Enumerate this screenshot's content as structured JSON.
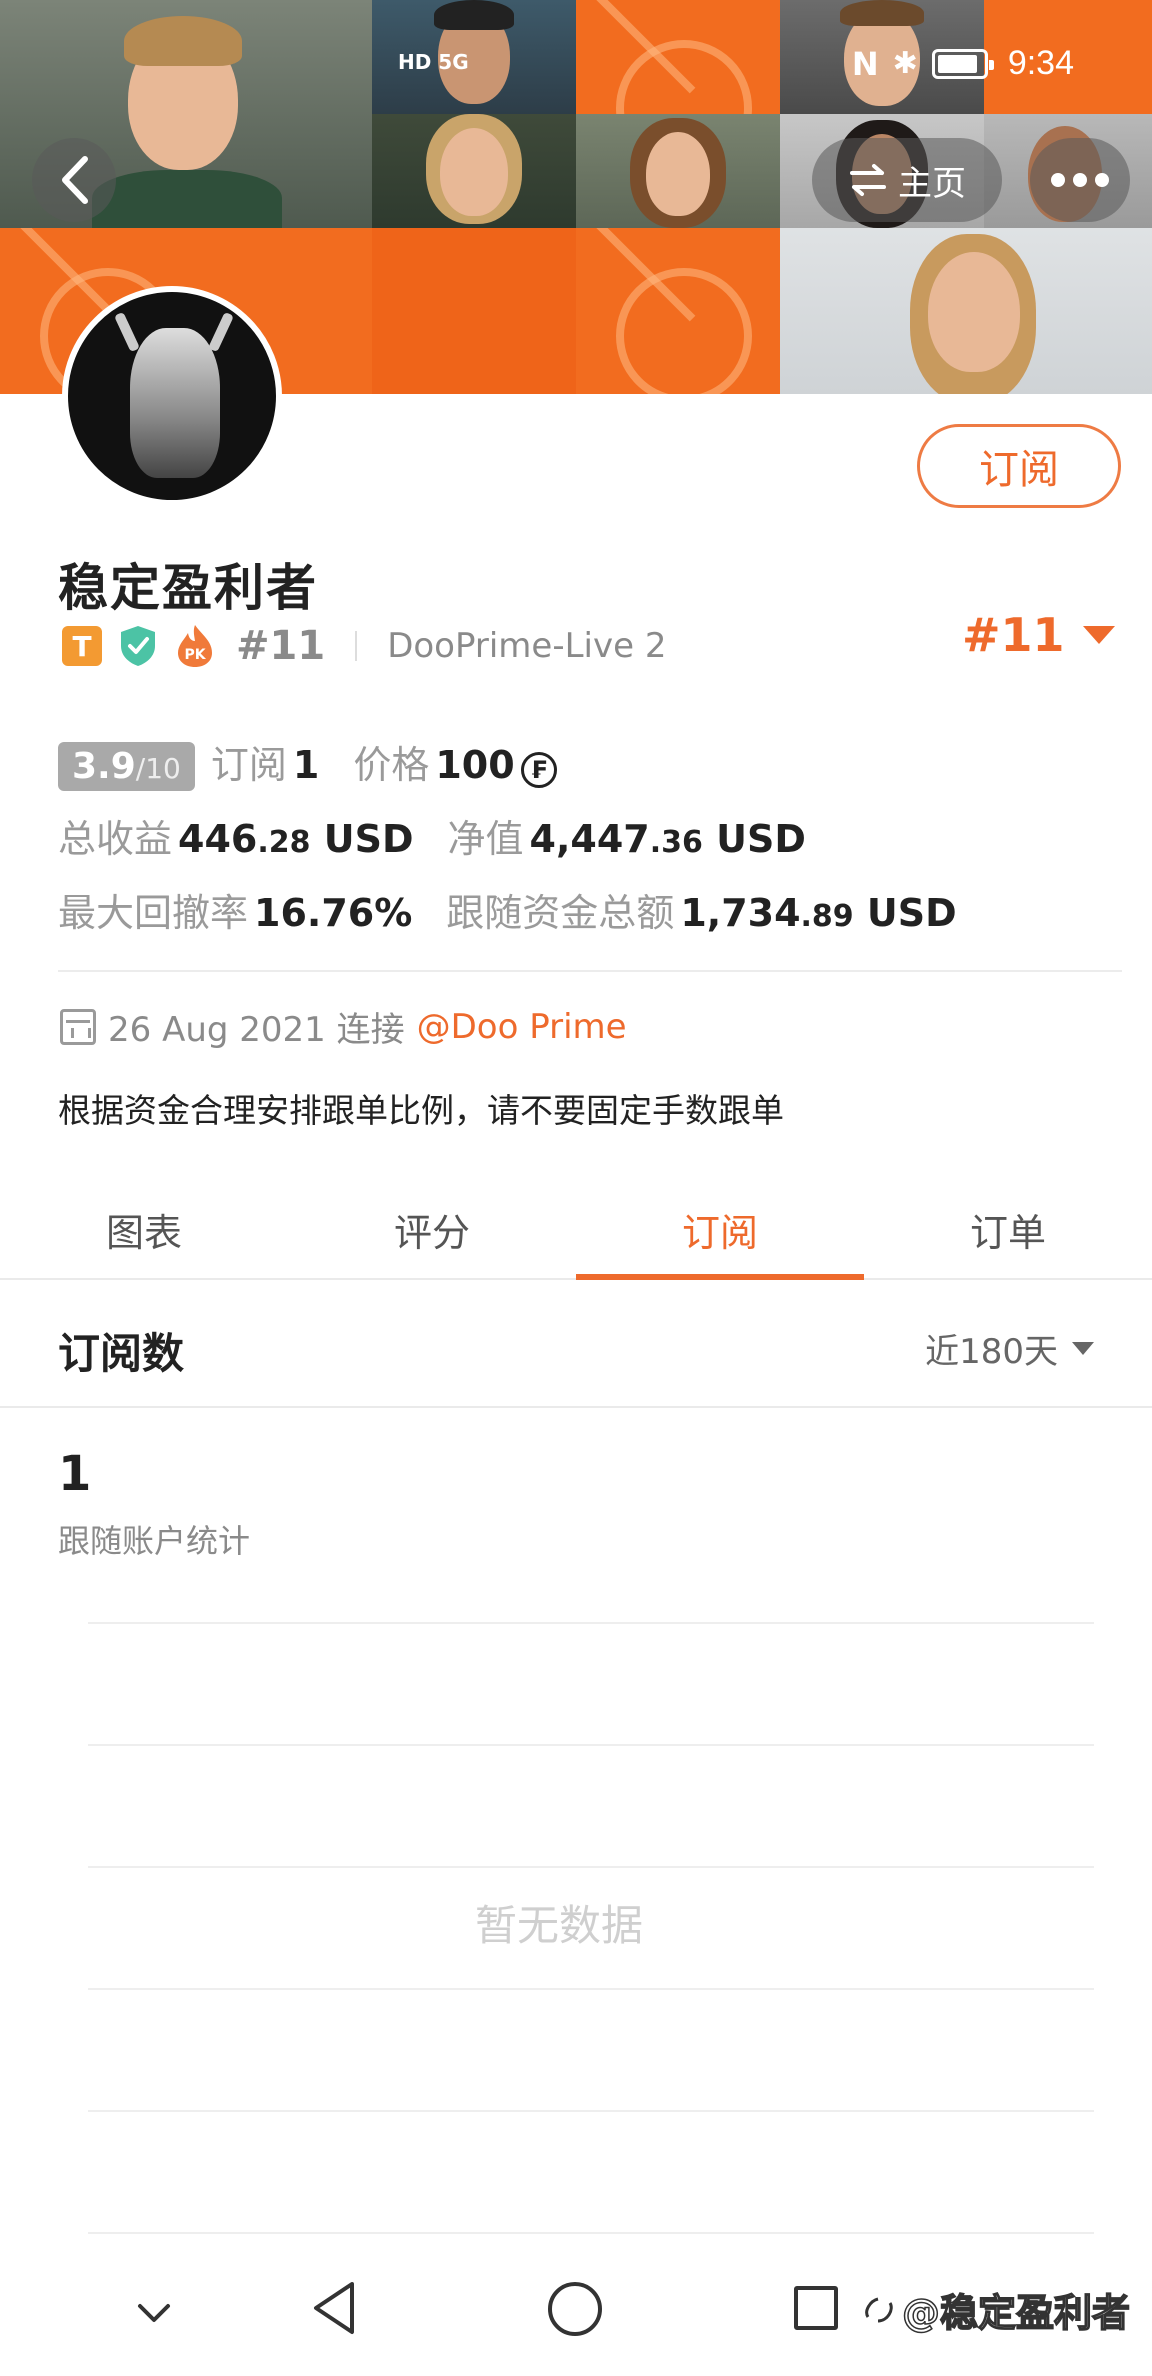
{
  "status_bar": {
    "left_indicators": "HD 5G",
    "nfc": "N",
    "bluetooth": "✱",
    "time": "9:34"
  },
  "header": {
    "home_label": "主页"
  },
  "profile": {
    "nickname": "稳定盈利者",
    "subscribe_label": "订阅",
    "badge_t": "T",
    "badge_pk": "PK",
    "rank": "#11",
    "server": "DooPrime-Live 2",
    "rank_big": "#11"
  },
  "stats": {
    "score": "3.9",
    "score_den": "/10",
    "subs_label": "订阅",
    "subs_value": "1",
    "price_label": "价格",
    "price_value": "100",
    "coin_symbol": "₣",
    "total_profit_label": "总收益",
    "total_profit_int": "446",
    "total_profit_dec": ".28",
    "total_profit_unit": "USD",
    "equity_label": "净值",
    "equity_int": "4,447",
    "equity_dec": ".36",
    "equity_unit": "USD",
    "drawdown_label": "最大回撤率",
    "drawdown_value": "16.76%",
    "follow_funds_label": "跟随资金总额",
    "follow_funds_int": "1,734",
    "follow_funds_dec": ".89",
    "follow_funds_unit": "USD"
  },
  "info": {
    "date_text": "26 Aug 2021 连接",
    "broker_link": "@Doo Prime",
    "description": "根据资金合理安排跟单比例，请不要固定手数跟单"
  },
  "tabs": [
    {
      "label": "图表"
    },
    {
      "label": "评分"
    },
    {
      "label": "订阅"
    },
    {
      "label": "订单"
    }
  ],
  "active_tab": "订阅",
  "section": {
    "title": "订阅数",
    "period": "近180天",
    "count": "1",
    "count_label": "跟随账户统计",
    "empty_text": "暂无数据"
  },
  "watermark": {
    "text": "@稳定盈利者"
  },
  "colors": {
    "accent": "#ee6a2c",
    "header_orange": "#f26c1f"
  }
}
